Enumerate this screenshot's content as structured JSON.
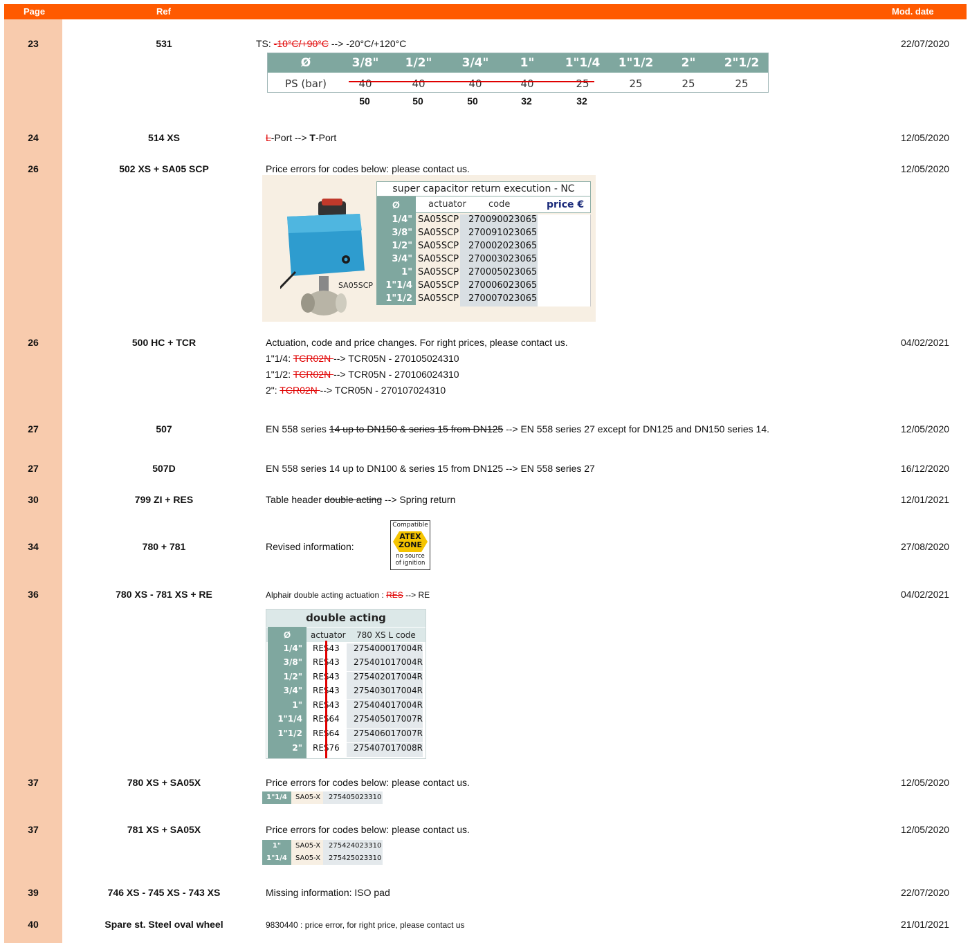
{
  "header": {
    "page": "Page",
    "ref": "Ref",
    "mod_date": "Mod. date"
  },
  "rows": [
    {
      "page": "23",
      "ref": "531",
      "date": "22/07/2020",
      "desc_prefix": "TS: ",
      "desc_old": "-10°C/+90°C",
      "desc_new": " --> -20°C/+120°C",
      "ts_table": {
        "head_label": "Ø",
        "sizes": [
          "3/8\"",
          "1/2\"",
          "3/4\"",
          "1\"",
          "1\"1/4",
          "1\"1/2",
          "2\"",
          "2\"1/2"
        ],
        "ps_label": "PS (bar)",
        "ps_values": [
          "40",
          "40",
          "40",
          "40",
          "25",
          "25",
          "25",
          "25"
        ],
        "new_values": [
          "50",
          "50",
          "50",
          "32",
          "32"
        ]
      }
    },
    {
      "page": "24",
      "ref": "514 XS",
      "date": "12/05/2020",
      "desc_old": "L",
      "desc_mid": "-Port --> ",
      "desc_bold": "T",
      "desc_end": "-Port"
    },
    {
      "page": "26",
      "ref": "502 XS + SA05 SCP",
      "date": "12/05/2020",
      "desc": "Price errors for codes below: please contact us.",
      "image_label": "SA05SCP",
      "scp_table": {
        "title": "super capacitor return execution - NC",
        "head_o": "Ø",
        "head_actuator": "actuator",
        "head_code": "code",
        "head_price": "price €",
        "rows": [
          {
            "d": "1/4\"",
            "a": "SA05SCP",
            "c": "270090023065"
          },
          {
            "d": "3/8\"",
            "a": "SA05SCP",
            "c": "270091023065"
          },
          {
            "d": "1/2\"",
            "a": "SA05SCP",
            "c": "270002023065"
          },
          {
            "d": "3/4\"",
            "a": "SA05SCP",
            "c": "270003023065"
          },
          {
            "d": "1\"",
            "a": "SA05SCP",
            "c": "270005023065"
          },
          {
            "d": "1\"1/4",
            "a": "SA05SCP",
            "c": "270006023065"
          },
          {
            "d": "1\"1/2",
            "a": "SA05SCP",
            "c": "270007023065"
          }
        ]
      }
    },
    {
      "page": "26",
      "ref": "500 HC + TCR",
      "date": "04/02/2021",
      "desc": "Actuation, code and price changes. For right prices, please contact us.",
      "lines": [
        {
          "pre": "1\"1/4: ",
          "old": "TCR02N ",
          "post": "--> TCR05N - 270105024310"
        },
        {
          "pre": "1\"1/2: ",
          "old": "TCR02N ",
          "post": "--> TCR05N - 270106024310"
        },
        {
          "pre": "2\": ",
          "old": "TCR02N ",
          "post": "--> TCR05N - 270107024310"
        }
      ]
    },
    {
      "page": "27",
      "ref": "507",
      "date": "12/05/2020",
      "desc_prefix": "EN 558 series ",
      "desc_old": "14 up to DN150 & series 15 from DN125",
      "desc_new": " --> EN 558 series 27 except for DN125 and DN150 series 14."
    },
    {
      "page": "27",
      "ref": "507D",
      "date": "16/12/2020",
      "desc": "EN 558 series 14 up to DN100 & series 15 from DN125 --> EN 558 series 27"
    },
    {
      "page": "30",
      "ref": "799 ZI + RES",
      "date": "12/01/2021",
      "desc_prefix": "Table header ",
      "desc_old": "double acting",
      "desc_new": " --> Spring return"
    },
    {
      "page": "34",
      "ref": "780 + 781",
      "date": "27/08/2020",
      "desc": "Revised information:",
      "atex": {
        "top": "Compatible",
        "zone1": "ATEX",
        "zone2": "ZONE",
        "bottom1": "no source",
        "bottom2": "of ignition"
      }
    },
    {
      "page": "36",
      "ref": "780 XS - 781 XS + RE",
      "date": "04/02/2021",
      "desc_prefix": "Alphair double acting actuation : ",
      "desc_old": "RES",
      "desc_new": " --> RE",
      "da_table": {
        "title": "double acting",
        "head_o": "Ø",
        "head_actuator": "actuator",
        "head_code": "780 XS L code",
        "rows": [
          {
            "d": "1/4\"",
            "a": "RES43",
            "c": "275400017004R"
          },
          {
            "d": "3/8\"",
            "a": "RES43",
            "c": "275401017004R"
          },
          {
            "d": "1/2\"",
            "a": "RES43",
            "c": "275402017004R"
          },
          {
            "d": "3/4\"",
            "a": "RES43",
            "c": "275403017004R"
          },
          {
            "d": "1\"",
            "a": "RES43",
            "c": "275404017004R"
          },
          {
            "d": "1\"1/4",
            "a": "RES64",
            "c": "275405017007R"
          },
          {
            "d": "1\"1/2",
            "a": "RES64",
            "c": "275406017007R"
          },
          {
            "d": "2\"",
            "a": "RES76",
            "c": "275407017008R"
          }
        ]
      }
    },
    {
      "page": "37",
      "ref": "780 XS + SA05X",
      "date": "12/05/2020",
      "desc": "Price errors for codes below: please contact us.",
      "strip": [
        {
          "d": "1\"1/4",
          "a": "SA05-X",
          "c": "275405023310"
        }
      ]
    },
    {
      "page": "37",
      "ref": "781 XS + SA05X",
      "date": "12/05/2020",
      "desc": "Price errors for codes below: please contact us.",
      "strip": [
        {
          "d": "1\"",
          "a": "SA05-X",
          "c": "275424023310"
        },
        {
          "d": "1\"1/4",
          "a": "SA05-X",
          "c": "275425023310"
        }
      ]
    },
    {
      "page": "39",
      "ref": "746 XS - 745 XS - 743 XS",
      "date": "22/07/2020",
      "desc": "Missing information: ISO pad"
    },
    {
      "page": "40",
      "ref": "Spare st. Steel oval wheel",
      "date": "21/01/2021",
      "desc": "9830440 : price error, for right price, please contact us"
    }
  ]
}
